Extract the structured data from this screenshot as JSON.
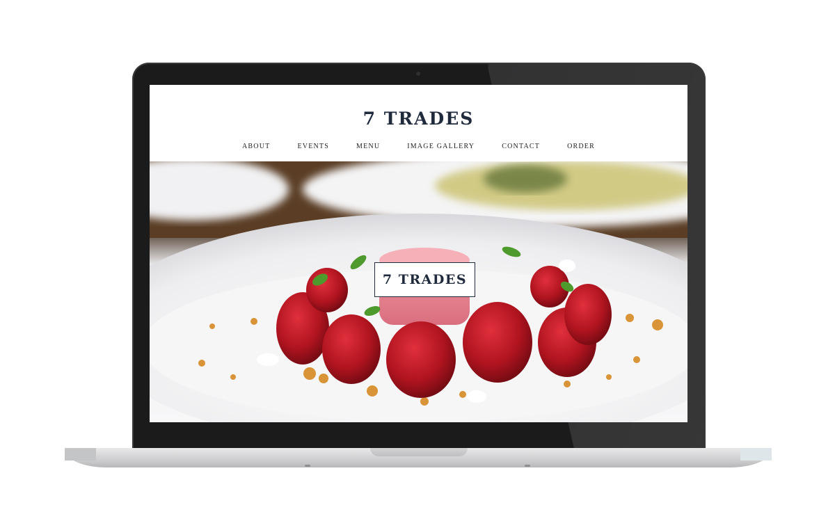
{
  "site": {
    "title": "7 TRADES",
    "nav": [
      "ABOUT",
      "EVENTS",
      "MENU",
      "IMAGE GALLERY",
      "CONTACT",
      "ORDER"
    ],
    "hero_badge": "7 TRADES"
  },
  "colors": {
    "brand_navy": "#1f2a3c",
    "laptop_bezel": "#1b1b1c",
    "laptop_base": "#c9c9cb"
  }
}
